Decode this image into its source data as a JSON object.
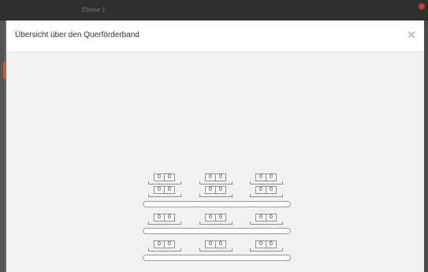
{
  "background": {
    "tab_label": "Ebene 1",
    "accent_color": "#c0602a",
    "close_dot_color": "#b8413a"
  },
  "modal": {
    "title": "Übersicht über den Querförderband",
    "close_icon": "close-icon"
  },
  "rows": [
    {
      "counters": [
        {
          "a": "0",
          "b": "0"
        },
        {
          "a": "0",
          "b": "0"
        },
        {
          "a": "0",
          "b": "0"
        }
      ]
    },
    {
      "counters": [
        {
          "a": "0",
          "b": "0"
        },
        {
          "a": "0",
          "b": "0"
        },
        {
          "a": "0",
          "b": "0"
        }
      ]
    },
    {
      "counters": [
        {
          "a": "0",
          "b": "0"
        },
        {
          "a": "0",
          "b": "0"
        },
        {
          "a": "0",
          "b": "0"
        }
      ]
    },
    {
      "counters": [
        {
          "a": "0",
          "b": "0"
        },
        {
          "a": "0",
          "b": "0"
        },
        {
          "a": "0",
          "b": "0"
        }
      ]
    }
  ]
}
